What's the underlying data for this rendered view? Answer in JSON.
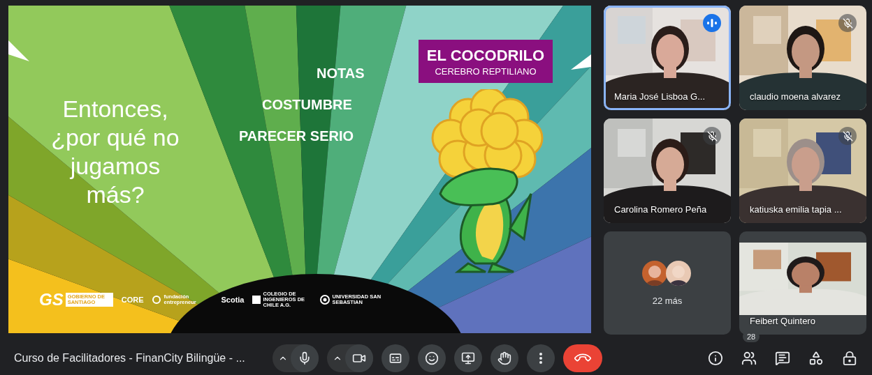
{
  "slide": {
    "heading": "Entonces, ¿por qué no jugamos más?",
    "words": [
      "NOTAS",
      "COSTUMBRE",
      "PARECER SERIO"
    ],
    "title_box": {
      "title": "EL COCODRILO",
      "subtitle": "CEREBRO REPTILIANO"
    },
    "logos": [
      {
        "kind": "gs",
        "mark": "GS",
        "text": "GOBIERNO DE SANTIAGO"
      },
      {
        "kind": "plain",
        "text": "CORE"
      },
      {
        "kind": "ring",
        "text": "fundación entrepreneur"
      },
      {
        "kind": "plain",
        "text": "Scotia"
      },
      {
        "kind": "square",
        "text": "COLEGIO DE INGENIEROS DE CHILE A.G."
      },
      {
        "kind": "seal",
        "text": "UNIVERSIDAD SAN SEBASTIAN"
      }
    ]
  },
  "participants": [
    {
      "name": "Maria José Lisboa G...",
      "speaking": true,
      "muted": false,
      "letterboxed": false
    },
    {
      "name": "claudio moena alvarez",
      "speaking": false,
      "muted": true,
      "letterboxed": false
    },
    {
      "name": "Carolina Romero Peña",
      "speaking": false,
      "muted": true,
      "letterboxed": false
    },
    {
      "name": "katiuska emilia tapia ...",
      "speaking": false,
      "muted": true,
      "letterboxed": false
    }
  ],
  "overflow_tile": {
    "label": "22 más"
  },
  "last_participant": {
    "name": "Feibert Quintero",
    "speaking": false,
    "muted": false,
    "letterboxed": true
  },
  "meeting_title": "Curso de Facilitadores - FinanCity Bilingüe - ...",
  "controls": [
    {
      "kind": "mic",
      "menu": true
    },
    {
      "kind": "camera",
      "menu": true
    },
    {
      "kind": "captions",
      "menu": false
    },
    {
      "kind": "emoji",
      "menu": false
    },
    {
      "kind": "present",
      "menu": false
    },
    {
      "kind": "hand",
      "menu": false
    },
    {
      "kind": "more",
      "menu": false
    },
    {
      "kind": "leave",
      "menu": false
    }
  ],
  "side_controls": [
    {
      "kind": "info"
    },
    {
      "kind": "people",
      "badge": "28"
    },
    {
      "kind": "chat"
    },
    {
      "kind": "activities"
    },
    {
      "kind": "host"
    }
  ]
}
